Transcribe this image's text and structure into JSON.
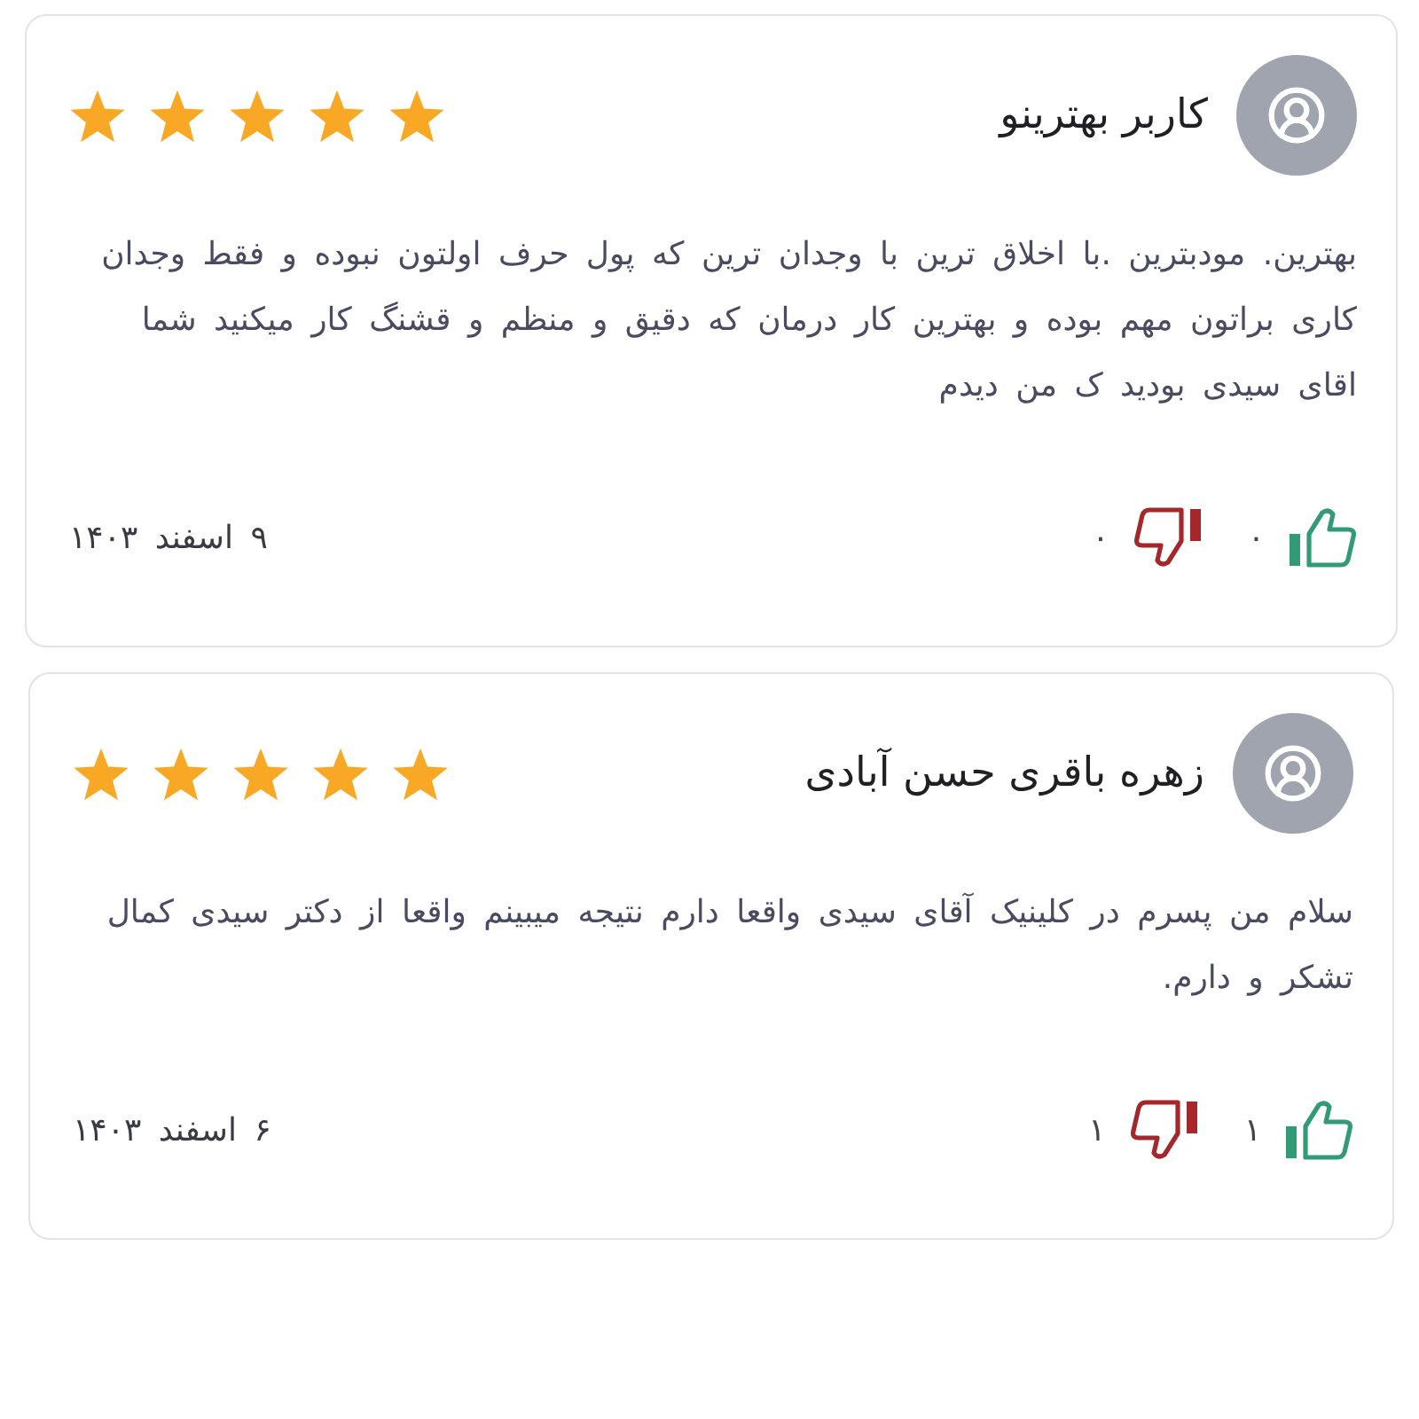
{
  "reviews": [
    {
      "author": "کاربر بهترینو",
      "stars": 5,
      "comment": "بهترین. مودبترین .با اخلاق ترین با وجدان ترین که پول حرف اولتون نبوده و فقط وجدان کاری براتون مهم بوده و بهترین کار درمان که دقیق و منظم و قشنگ کار میکنید شما اقای سیدی بودید ک من دیدم",
      "likes": "۰",
      "dislikes": "۰",
      "date": "۹ اسفند ۱۴۰۳"
    },
    {
      "author": "زهره باقری حسن آبادی",
      "stars": 5,
      "comment": "سلام من پسرم در کلینیک آقای سیدی واقعا دارم نتیجه میبینم واقعا از دکتر سیدی کمال تشکر و دارم.",
      "likes": "۱",
      "dislikes": "۱",
      "date": "۶ اسفند ۱۴۰۳"
    }
  ]
}
